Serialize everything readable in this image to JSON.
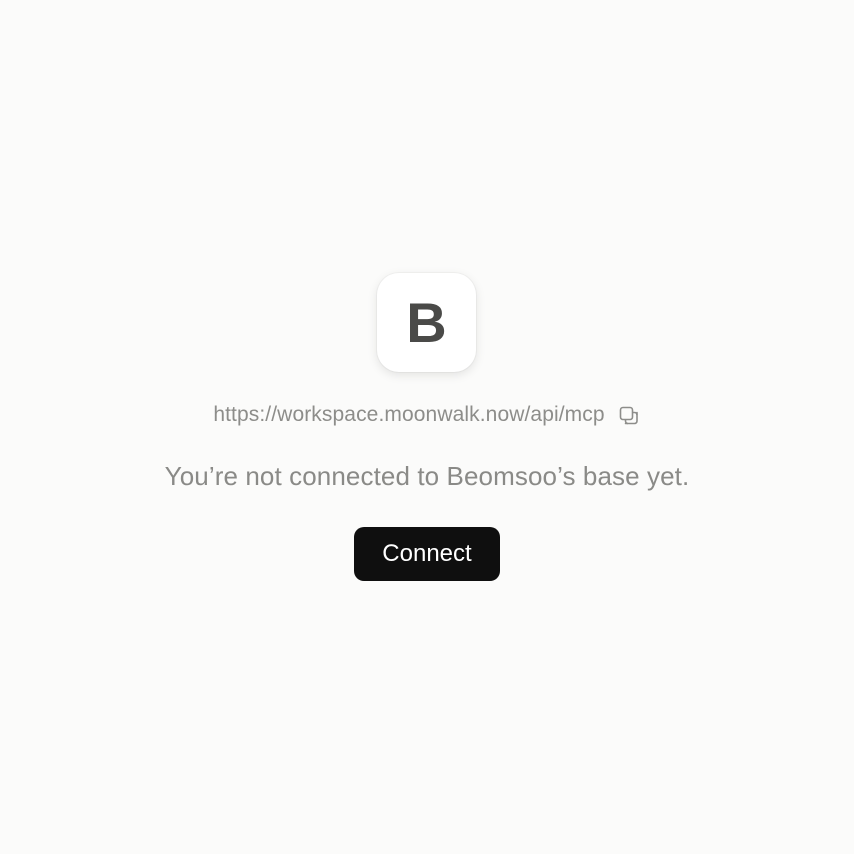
{
  "workspace": {
    "avatar_letter": "B",
    "server_url": "https://workspace.moonwalk.now/api/mcp",
    "copy_icon": "copy-icon",
    "status_message": "You’re not connected to Beomsoo’s base yet.",
    "connect_label": "Connect"
  },
  "colors": {
    "background": "#fbfbfa",
    "button": "#0f0f0f",
    "muted_text": "#8d8d8a"
  }
}
